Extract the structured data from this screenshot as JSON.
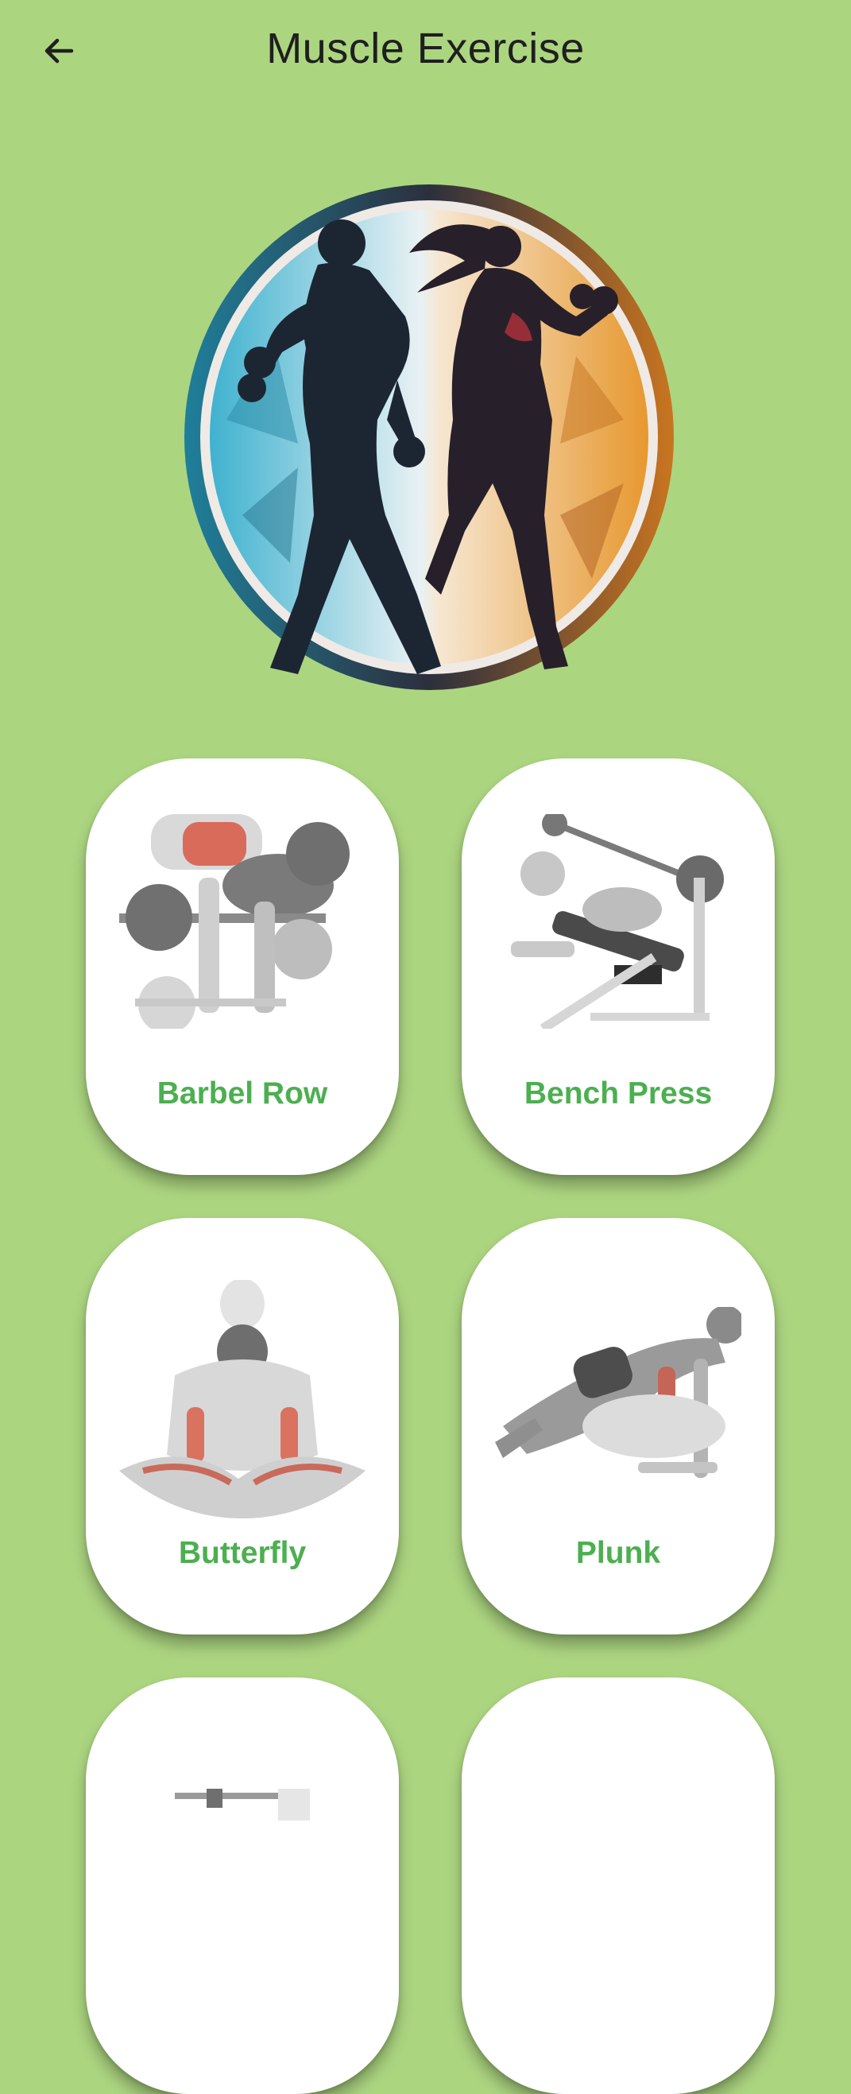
{
  "header": {
    "title": "Muscle Exercise",
    "back_icon": "arrow-left-icon"
  },
  "logo": {
    "icon": "fitness-couple-logo",
    "colors": {
      "left": "#3aa6c2",
      "right": "#e59a3a",
      "ring": "#5a2f3a",
      "figure": "#1c2633"
    }
  },
  "accent_color": "#4caf50",
  "background_color": "#acd580",
  "exercises": [
    {
      "label": "Barbel Row",
      "icon": "barbel-row-illustration"
    },
    {
      "label": "Bench Press",
      "icon": "bench-press-illustration"
    },
    {
      "label": "Butterfly",
      "icon": "butterfly-stretch-illustration"
    },
    {
      "label": "Plunk",
      "icon": "plank-illustration"
    },
    {
      "label": "",
      "icon": "barbell-illustration"
    },
    {
      "label": "",
      "icon": "exercise-illustration"
    }
  ]
}
